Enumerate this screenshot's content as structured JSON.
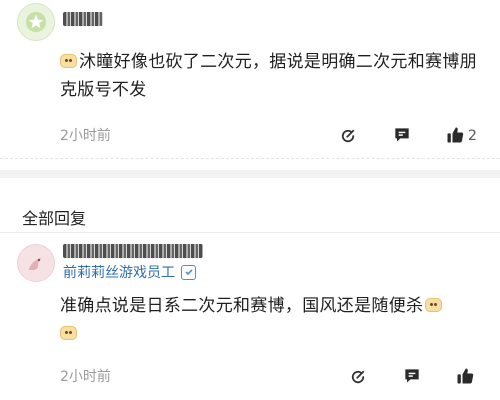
{
  "top_comment": {
    "text": "沐瞳好像也砍了二次元，据说是明确二次元和赛博朋克版号不发",
    "time": "2小时前",
    "likes": "2"
  },
  "section": {
    "title": "全部回复"
  },
  "reply": {
    "subtitle": "前莉莉丝游戏员工",
    "text": "准确点说是日系二次元和赛博，国风还是随便杀",
    "time": "2小时前"
  },
  "icons": {
    "avatar_top": "star-avatar-icon",
    "avatar_reply": "bird-avatar-icon",
    "comment": "comment-edit-icon",
    "reply": "message-icon",
    "like": "thumbs-up-icon",
    "verified": "verified-badge-icon"
  }
}
